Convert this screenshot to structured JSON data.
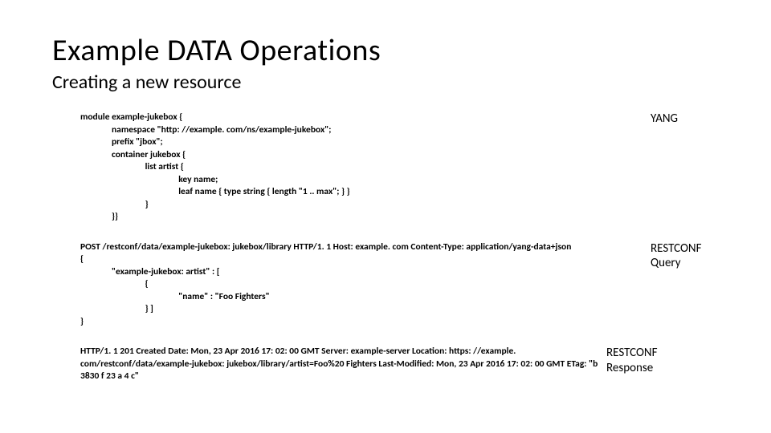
{
  "title": "Example DATA Operations",
  "subtitle": "Creating a new resource",
  "sections": {
    "yang": {
      "label": "YANG",
      "code": "module example-jukebox {\n               namespace \"http: //example. com/ns/example-jukebox\";\n               prefix \"jbox\";\n               container jukebox {\n                               list artist {\n                                               key name;\n                                               leaf name { type string { length \"1 .. max\"; } }\n                               }\n               }}"
    },
    "query": {
      "label": "RESTCONF Query",
      "code": "POST /restconf/data/example-jukebox: jukebox/library HTTP/1. 1 Host: example. com Content-Type: application/yang-data+json\n{\n               \"example-jukebox: artist\" : [\n                               {\n                                               \"name\" : \"Foo Fighters\"\n                               } ]\n}"
    },
    "response": {
      "label": "RESTCONF Response",
      "code": "HTTP/1. 1 201 Created Date: Mon, 23 Apr 2016 17: 02: 00 GMT Server: example-server Location: https: //example. com/restconf/data/example-jukebox: jukebox/library/artist=Foo%20 Fighters Last-Modified: Mon, 23 Apr 2016 17: 02: 00 GMT ETag: \"b 3830 f 23 a 4 c\""
    }
  }
}
